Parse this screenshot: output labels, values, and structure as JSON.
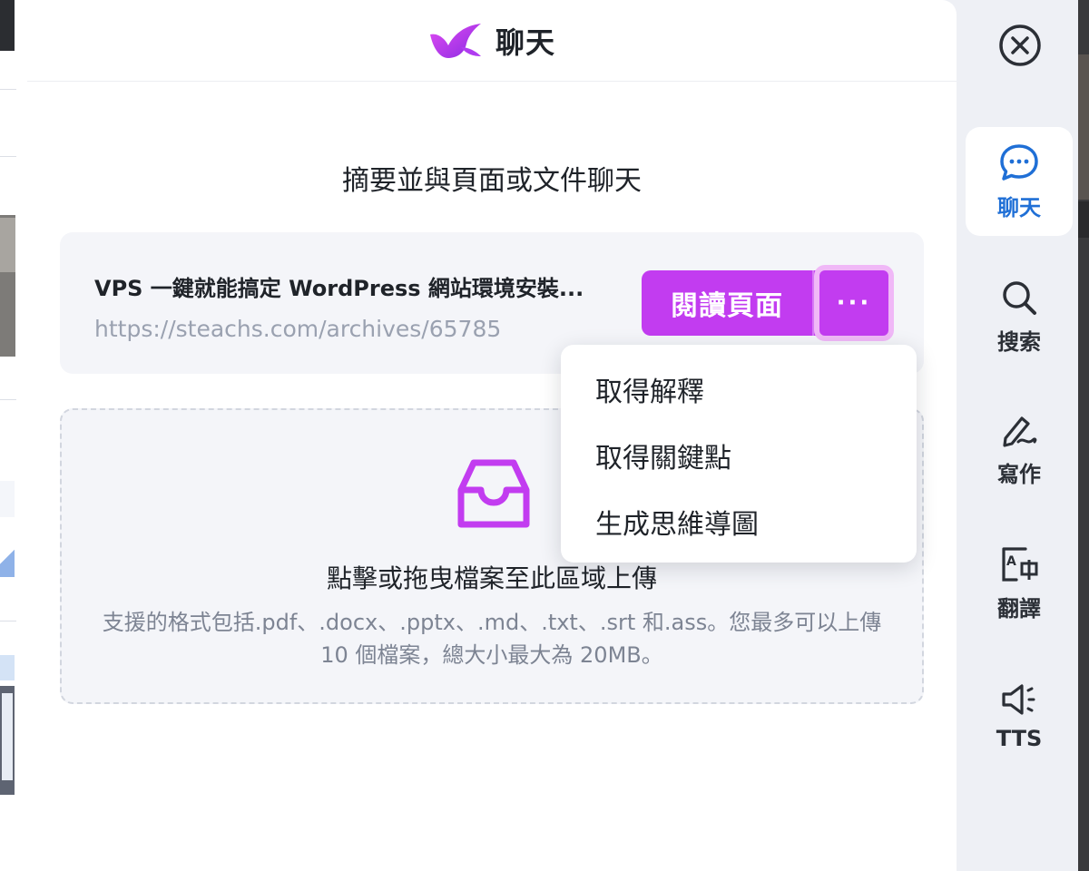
{
  "header": {
    "title": "聊天",
    "logo_icon": "bird-logo-icon"
  },
  "main": {
    "subtitle": "摘要並與頁面或文件聊天",
    "page_card": {
      "title": "VPS 一鍵就能搞定 WordPress 網站環境安裝...",
      "url": "https://steachs.com/archives/65785",
      "read_button_label": "閱讀頁面",
      "more_button_label": "···"
    },
    "upload": {
      "icon": "inbox-tray-icon",
      "title": "點擊或拖曳檔案至此區域上傳",
      "description": "支援的格式包括.pdf、.docx、.pptx、.md、.txt、.srt 和.ass。您最多可以上傳 10 個檔案，總大小最大為 20MB。"
    }
  },
  "dropdown": {
    "items": [
      {
        "label": "取得解釋"
      },
      {
        "label": "取得關鍵點"
      },
      {
        "label": "生成思維導圖"
      }
    ]
  },
  "sidebar": {
    "close_icon": "close-circle-icon",
    "items": [
      {
        "label": "聊天",
        "icon": "chat-bubble-icon",
        "active": true
      },
      {
        "label": "搜索",
        "icon": "search-icon",
        "active": false
      },
      {
        "label": "寫作",
        "icon": "pen-write-icon",
        "active": false
      },
      {
        "label": "翻譯",
        "icon": "translate-icon",
        "active": false
      },
      {
        "label": "TTS",
        "icon": "speaker-icon",
        "active": false
      }
    ]
  },
  "colors": {
    "accent": "#c23cf0",
    "accent_ring": "#f0b8f7",
    "active_blue": "#1f6fd6",
    "panel_bg": "#ffffff",
    "card_bg": "#f4f5f9"
  }
}
